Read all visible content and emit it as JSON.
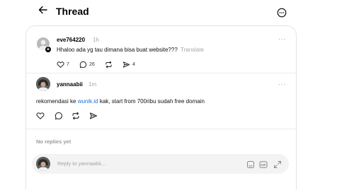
{
  "header": {
    "title": "Thread"
  },
  "original_post": {
    "username": "eve764220",
    "time": "1h",
    "text": "Hhaloo ada yg tau dimana bisa buat website???",
    "translate_label": "Translate",
    "more": "···",
    "likes": "7",
    "comments": "26",
    "shares": "4"
  },
  "reply": {
    "username": "yannaabii",
    "time": "1m",
    "text_before": "rekomendasi ke ",
    "link": "wunik.id",
    "text_after": " kak, start from 700ribu sudah free domain",
    "more": "···"
  },
  "no_replies": "No replies yet",
  "reply_input": {
    "placeholder": "Reply to yannaabii..."
  },
  "icons": {
    "back": "arrow-left-icon",
    "more": "more-circle-icon",
    "like": "heart-icon",
    "comment": "comment-icon",
    "repost": "repost-icon",
    "share": "send-icon",
    "gif": "gif-icon",
    "emoji": "sticker-icon",
    "expand": "expand-icon"
  }
}
